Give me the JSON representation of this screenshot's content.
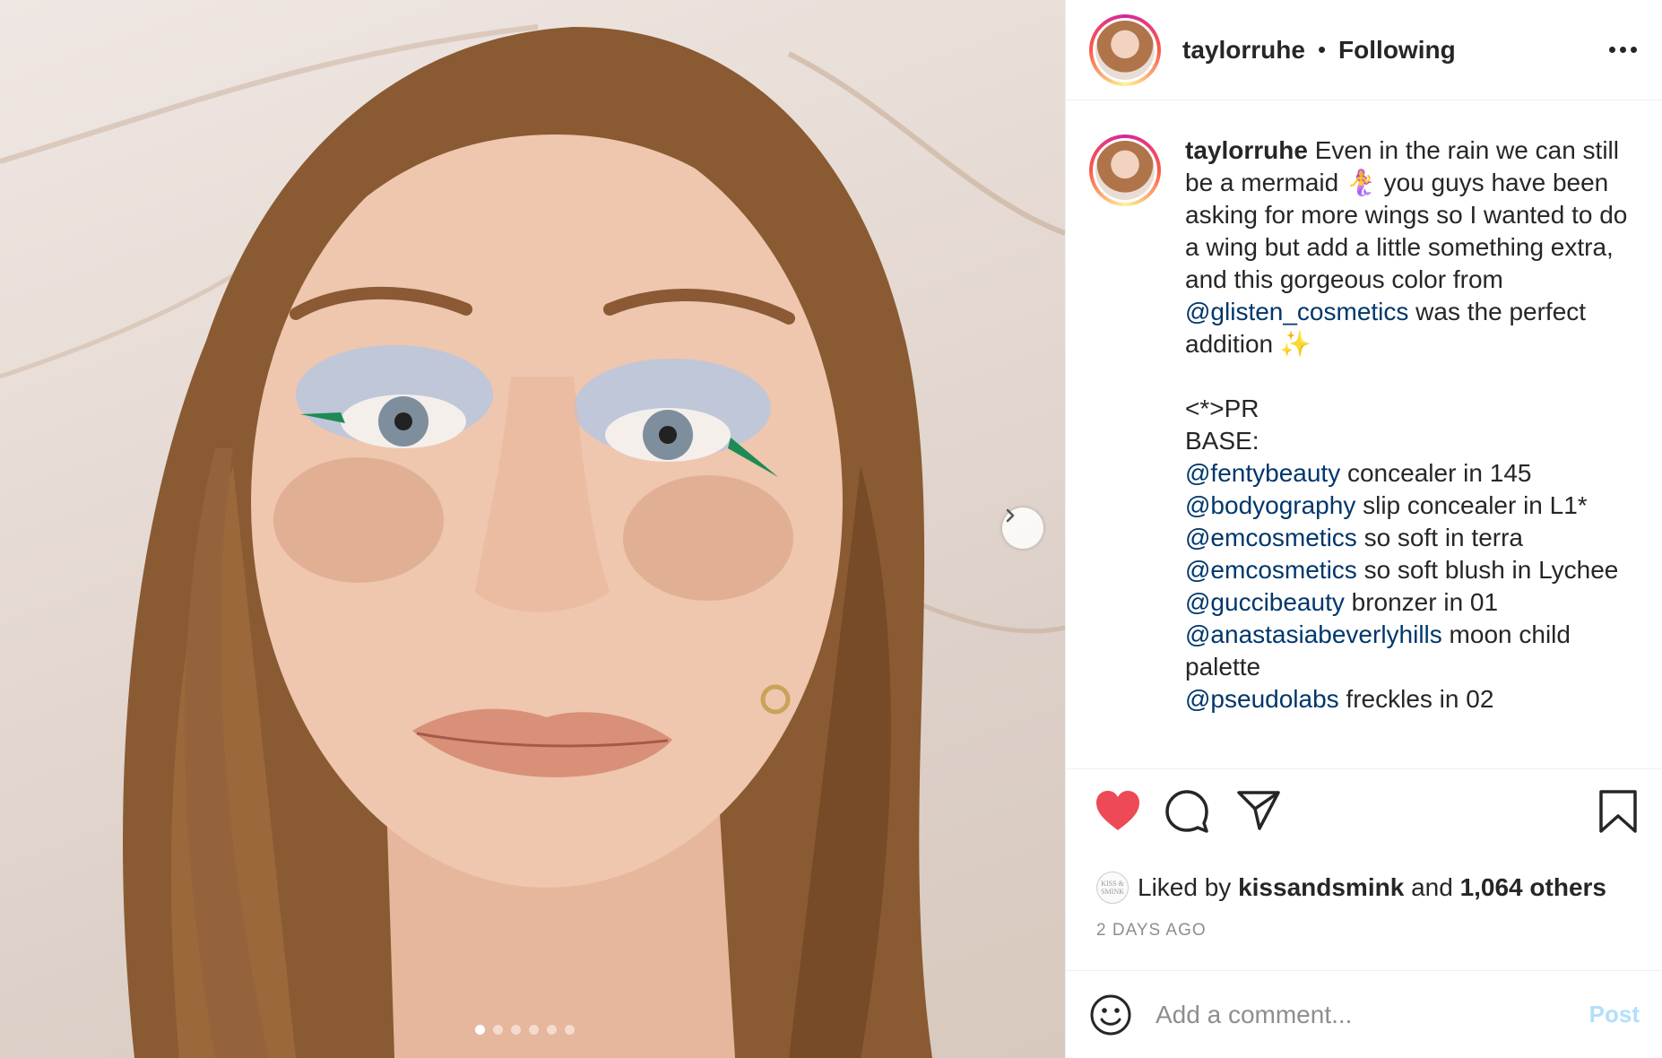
{
  "post": {
    "username": "taylorruhe",
    "separator": "•",
    "follow_status": "Following",
    "carousel_count": 6,
    "carousel_active_index": 0
  },
  "caption": {
    "username": "taylorruhe",
    "intro_1": " Even in the rain we can still be a mermaid 🧜‍♀️ you guys have been asking for more wings so I wanted to do a wing but add a little something extra, and this gorgeous color from ",
    "mention_glisten": "@glisten_cosmetics",
    "intro_2": " was the perfect addition ✨",
    "pr_line": "<*>PR",
    "base_line": "BASE:",
    "products": [
      {
        "mention": "@fentybeauty",
        "text": " concealer in 145"
      },
      {
        "mention": "@bodyography",
        "text": " slip concealer in L1*"
      },
      {
        "mention": "@emcosmetics",
        "text": " so soft in terra"
      },
      {
        "mention": "@emcosmetics",
        "text": " so soft blush in Lychee"
      },
      {
        "mention": "@guccibeauty",
        "text": " bronzer in 01"
      },
      {
        "mention": "@anastasiabeverlyhills",
        "text": " moon child palette"
      },
      {
        "mention": "@pseudolabs",
        "text": " freckles in 02"
      }
    ]
  },
  "likes": {
    "prefix": "Liked by ",
    "liker": "kissandsmink",
    "middle": " and ",
    "others": "1,064 others",
    "liker_avatar_text": "KISS & SMINK"
  },
  "timestamp": "2 DAYS AGO",
  "comment": {
    "placeholder": "Add a comment...",
    "post_label": "Post"
  },
  "colors": {
    "heart": "#ed4956",
    "mention": "#00376b",
    "post_disabled": "#b2dffc"
  },
  "icons": [
    "heart-icon",
    "comment-icon",
    "share-icon",
    "bookmark-icon",
    "emoji-icon",
    "chevron-right-icon",
    "more-icon"
  ]
}
